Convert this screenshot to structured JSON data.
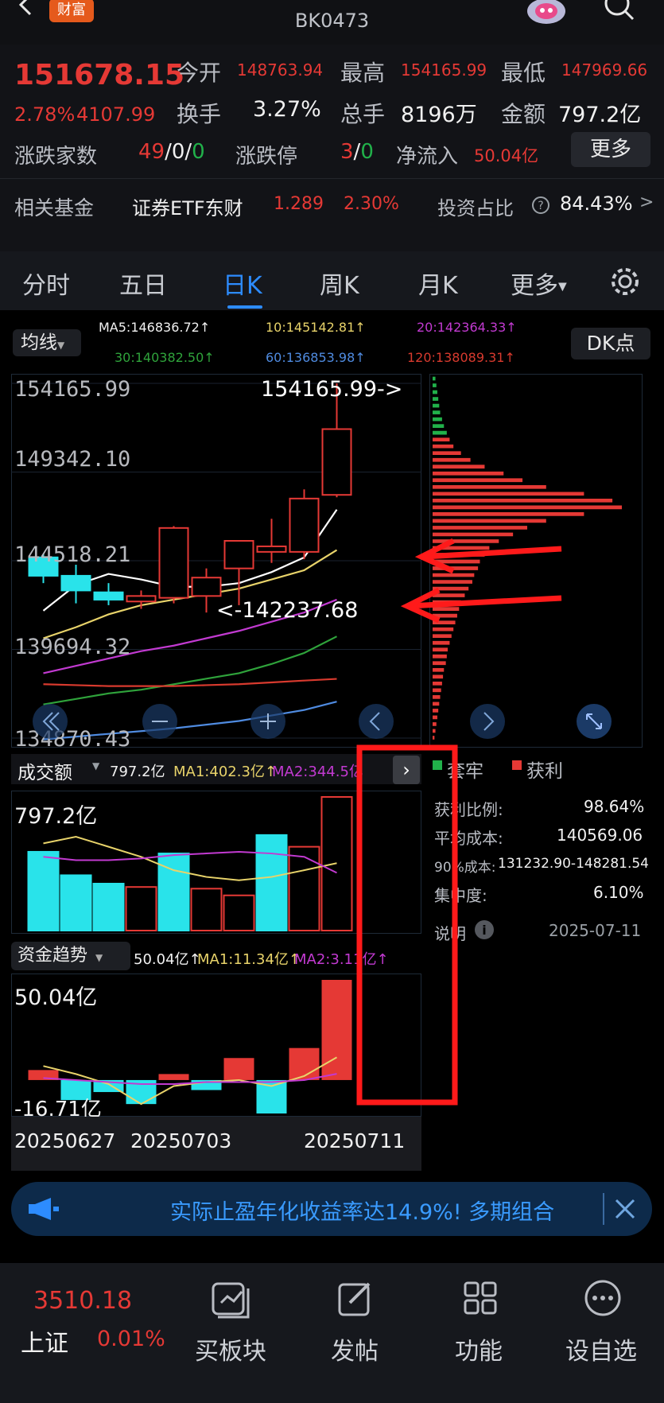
{
  "header": {
    "badge": "财富",
    "code": "BK0473"
  },
  "quote": {
    "price": "151678.15",
    "change_pct": "2.78%",
    "change_abs": "4107.99",
    "open_label": "今开",
    "open": "148763.94",
    "high_label": "最高",
    "high": "154165.99",
    "low_label": "最低",
    "low": "147969.66",
    "turnover_label": "换手",
    "turnover": "3.27%",
    "volume_label": "总手",
    "volume": "8196万",
    "amount_label": "金额",
    "amount": "797.2亿",
    "breadth_label": "涨跌家数",
    "breadth_up": "49",
    "breadth_sep1": "/",
    "breadth_flat": "0",
    "breadth_sep2": "/",
    "breadth_down": "0",
    "limit_label": "涨跌停",
    "limit_up": "3",
    "limit_sep": "/",
    "limit_down": "0",
    "netflow_label": "净流入",
    "netflow": "50.04亿",
    "more_button": "更多",
    "fund_label": "相关基金",
    "fund_name": "证券ETF东财",
    "fund_price": "1.289",
    "fund_pct": "2.30%",
    "ratio_label": "投资占比",
    "ratio": "84.43%",
    "ratio_arrow": ">"
  },
  "tabs": [
    "分时",
    "五日",
    "日K",
    "周K",
    "月K",
    "更多"
  ],
  "active_tab": 2,
  "ma": {
    "selector": "均线",
    "ma5": "MA5:146836.72↑",
    "ma10": "10:145142.81↑",
    "ma20": "20:142364.33↑",
    "ma30": "30:140382.50↑",
    "ma60": "60:136853.98↑",
    "ma120": "120:138089.31↑",
    "dk": "DK点"
  },
  "price_axis": [
    "154165.99",
    "149342.10",
    "144518.21",
    "139694.32",
    "134870.43"
  ],
  "annotations": {
    "high_mark": "154165.99->",
    "low_mark": "<-142237.68"
  },
  "volume_panel": {
    "title": "成交额",
    "value": "797.2亿",
    "ma1": "MA1:402.3亿↑",
    "ma2": "MA2:344.5亿",
    "axis_top": "797.2亿"
  },
  "flow_panel": {
    "title": "资金趋势",
    "value": "50.04亿↑",
    "ma1": "MA1:11.34亿↑",
    "ma2": "MA2:3.11亿↑",
    "axis_top": "50.04亿",
    "axis_bottom": "-16.71亿"
  },
  "dates": [
    "20250627",
    "20250703",
    "20250711"
  ],
  "chip": {
    "legend_trapped": "套牢",
    "legend_profit": "获利",
    "rows": [
      {
        "label": "获利比例:",
        "value": "98.64%"
      },
      {
        "label": "平均成本:",
        "value": "140569.06"
      },
      {
        "label": "90%成本:",
        "value": "131232.90-148281.54"
      },
      {
        "label": "集中度:",
        "value": "6.10%"
      }
    ],
    "note_label": "说明",
    "date": "2025-07-11"
  },
  "promo": {
    "text": "实际止盈年化收益率达14.9%! 多期组合"
  },
  "bottom": {
    "index_price": "3510.18",
    "index_name": "上证",
    "index_pct": "0.01%",
    "nav": [
      "买板块",
      "发帖",
      "功能",
      "设自选"
    ]
  },
  "colors": {
    "up": "#e53935",
    "down": "#29e3ea",
    "accent": "#2d8cff"
  },
  "chart_data": {
    "type": "candlestick",
    "yrange": [
      134870.43,
      154165.99
    ],
    "candles": [
      {
        "o": 144700,
        "h": 144900,
        "l": 143300,
        "c": 143700
      },
      {
        "o": 143700,
        "h": 144300,
        "l": 142200,
        "c": 142900
      },
      {
        "o": 142800,
        "h": 143300,
        "l": 142100,
        "c": 142400
      },
      {
        "o": 142300,
        "h": 142900,
        "l": 141900,
        "c": 142600
      },
      {
        "o": 142500,
        "h": 146400,
        "l": 142200,
        "c": 146300
      },
      {
        "o": 142600,
        "h": 144100,
        "l": 141700,
        "c": 143600
      },
      {
        "o": 144100,
        "h": 145600,
        "l": 142100,
        "c": 145600
      },
      {
        "o": 145000,
        "h": 146800,
        "l": 144400,
        "c": 145300
      },
      {
        "o": 145000,
        "h": 148400,
        "l": 144600,
        "c": 147900
      },
      {
        "o": 148100,
        "h": 154165.99,
        "l": 147969.66,
        "c": 151678.15
      }
    ],
    "ma_lines": [
      {
        "name": "MA5",
        "color": "#ffffff",
        "values": [
          141800,
          143200,
          143800,
          143500,
          143100,
          143100,
          143300,
          143900,
          144700,
          147300
        ]
      },
      {
        "name": "MA10",
        "color": "#e8d36a",
        "values": [
          140300,
          140900,
          141600,
          142100,
          142400,
          142700,
          143000,
          143500,
          144000,
          145100
        ]
      },
      {
        "name": "MA20",
        "color": "#c23ad1",
        "values": [
          138400,
          138800,
          139200,
          139600,
          139900,
          140300,
          140700,
          141200,
          141700,
          142400
        ]
      },
      {
        "name": "MA30",
        "color": "#2fa33b",
        "values": [
          136700,
          137000,
          137300,
          137500,
          137800,
          138100,
          138400,
          138900,
          139500,
          140400
        ]
      },
      {
        "name": "MA60",
        "color": "#4f8be0",
        "values": [
          134800,
          134950,
          135100,
          135250,
          135400,
          135600,
          135800,
          136100,
          136400,
          136850
        ]
      },
      {
        "name": "MA120",
        "color": "#d83a2e",
        "values": [
          137800,
          137750,
          137700,
          137700,
          137700,
          137750,
          137800,
          137900,
          138000,
          138090
        ]
      }
    ],
    "volume_range": [
      0,
      797.2
    ],
    "volume": [
      {
        "v": 470,
        "up": false
      },
      {
        "v": 330,
        "up": false
      },
      {
        "v": 280,
        "up": false
      },
      {
        "v": 260,
        "up": true
      },
      {
        "v": 460,
        "up": false
      },
      {
        "v": 250,
        "up": true
      },
      {
        "v": 210,
        "up": true
      },
      {
        "v": 570,
        "up": false
      },
      {
        "v": 500,
        "up": true
      },
      {
        "v": 797.2,
        "up": true
      }
    ],
    "volume_ma1": [
      520,
      560,
      500,
      440,
      360,
      320,
      300,
      320,
      360,
      402.3
    ],
    "volume_ma2": [
      440,
      420,
      420,
      430,
      450,
      460,
      470,
      460,
      440,
      344.5
    ],
    "flow_range": [
      -16.71,
      50.04
    ],
    "flow": [
      5,
      -10,
      -6,
      -12,
      3,
      -5,
      11,
      -16.71,
      16,
      50.04
    ],
    "flow_ma1": [
      7,
      3,
      -2,
      -12,
      -3,
      -1,
      0,
      -3,
      2,
      11.34
    ],
    "flow_ma2": [
      1,
      0,
      -1,
      -2,
      -2,
      -1,
      -1,
      -1,
      0,
      3.11
    ],
    "chip_profile": [
      3,
      4,
      5,
      6,
      7,
      8,
      10,
      12,
      15,
      18,
      22,
      30,
      40,
      55,
      75,
      95,
      120,
      160,
      190,
      200,
      160,
      120,
      100,
      85,
      70,
      60,
      55,
      50,
      48,
      44,
      42,
      38,
      34,
      30,
      28,
      26,
      24,
      22,
      20,
      18,
      16,
      15,
      14,
      12,
      11,
      10,
      9,
      8,
      7,
      6,
      5,
      4,
      3,
      2
    ],
    "chip_split_index": 9
  }
}
